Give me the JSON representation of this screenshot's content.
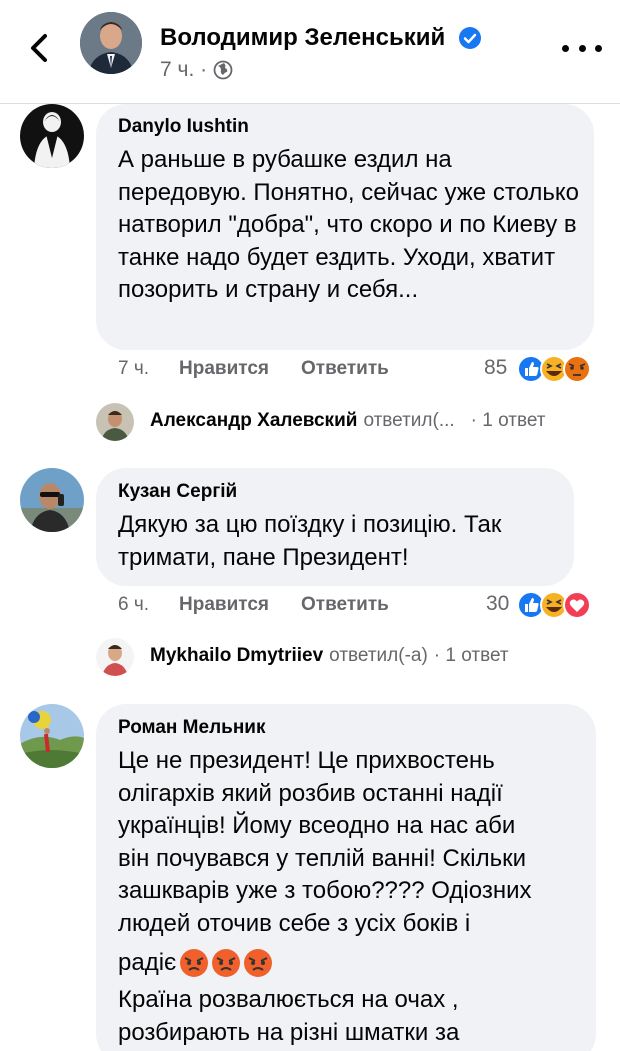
{
  "header": {
    "name": "Володимир Зеленський",
    "time": "7 ч. ·"
  },
  "comments": [
    {
      "author": "Danylo Iushtin",
      "text": "А раньше в рубашке ездил на передовую. Понятно, сейчас уже столько натворил \"добра\", что скоро и по Киеву в танке надо будет ездить. Уходи, хватит позорить и страну и себя...",
      "time": "7 ч.",
      "like_label": "Нравится",
      "reply_label": "Ответить",
      "reactions": "85",
      "reply_summary": {
        "author": "Александр Халевский",
        "action": "ответил(...",
        "count": "· 1 ответ"
      }
    },
    {
      "author": "Кузан Сергій",
      "text": "Дякую за цю поїздку і позицію. Так тримати, пане Президент!",
      "time": "6 ч.",
      "like_label": "Нравится",
      "reply_label": "Ответить",
      "reactions": "30",
      "reply_summary": {
        "author": "Mykhailo Dmytriiev",
        "action": "ответил(-а)",
        "count": "· 1 ответ"
      }
    },
    {
      "author": "Роман Мельник",
      "text_lines": [
        "Це не президент! Це прихвостень",
        "олігархів який розбив останні надії",
        "українців! Йому всеодно на нас аби",
        "він почувався у теплій ванні! Скільки",
        "зашкварів уже з тобою???? Одіозних",
        "людей оточив себе з усіх боків і",
        "радіє",
        "Країна розвалюється на очах ,",
        "розбирають на різні шматки за"
      ]
    }
  ],
  "icons": {
    "back": "chevron-left-icon",
    "verified": "verified-badge-icon",
    "globe": "globe-icon",
    "more": "more-options-icon",
    "like": "like-reaction-icon",
    "haha": "haha-reaction-icon",
    "angry": "angry-reaction-icon",
    "love": "love-reaction-icon"
  },
  "colors": {
    "bubble": "#f0f2f5",
    "secondary_text": "#65676b",
    "like_blue": "#1877f2",
    "angry_red": "#e9710f",
    "love_red": "#f33e58",
    "haha_yellow": "#f7b125"
  }
}
